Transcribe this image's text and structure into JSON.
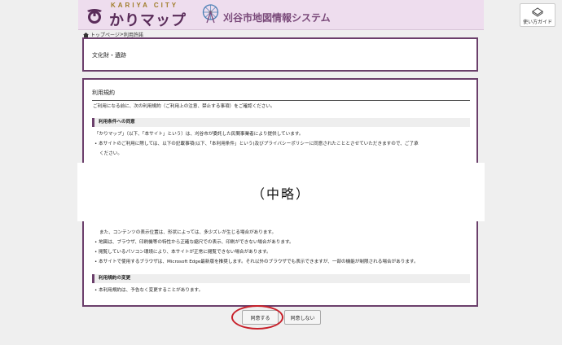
{
  "header": {
    "brand_en": "KARIYA CITY",
    "brand_jp": "かりマップ",
    "system_title": "刈谷市地図情報システム",
    "guide_label": "使い方ガイド"
  },
  "breadcrumb": {
    "home": "トップページ",
    "separator": ">",
    "current": "利用許諾"
  },
  "category": "文化財・遺跡",
  "terms": {
    "title": "利用規約",
    "intro": "ご利用になる前に、次の利用規約（ご利用上の注意、禁止する事項）をご確認ください。",
    "section1": "利用条件への同意",
    "s1_line1": "「かりマップ」（以下、「本サイト」という）は、刈谷市が委託した民間事業者により提供しています。",
    "s1_line2": "• 本サイトのご利用に際しては、以下の記載事項(以下、「本利用条件」という)及びプライバシーポリシーに同意されたこととさせていただきますので、ご了承",
    "s1_line3": "ください。",
    "mid_line1": "また、コンテンツの表示位置は、形状によっては、多少ズレが生じる場合があります。",
    "mid_line2": "• 地図は、ブラウザ、印刷機等の特性から正確な縮尺での表示、印刷ができない場合があります。",
    "mid_line3": "• 閲覧しているパソコン環境により、本サイトが正常に閲覧できない場合があります。",
    "mid_line4": "• 本サイトで使用するブラウザは、Microsoft Edge最新版を推奨します。それ以外のブラウザでも表示できますが、一部の機能が制限される場合があります。",
    "section2": "利用規約の変更",
    "s2_line1": "• 本利用規約は、予告なく変更することがあります。"
  },
  "omission_note": "（中略）",
  "buttons": {
    "agree": "同意する",
    "disagree": "同意しない"
  },
  "colors": {
    "header_bg": "#eeddee",
    "accent": "#6b3f6b",
    "highlight": "#c8202a"
  }
}
